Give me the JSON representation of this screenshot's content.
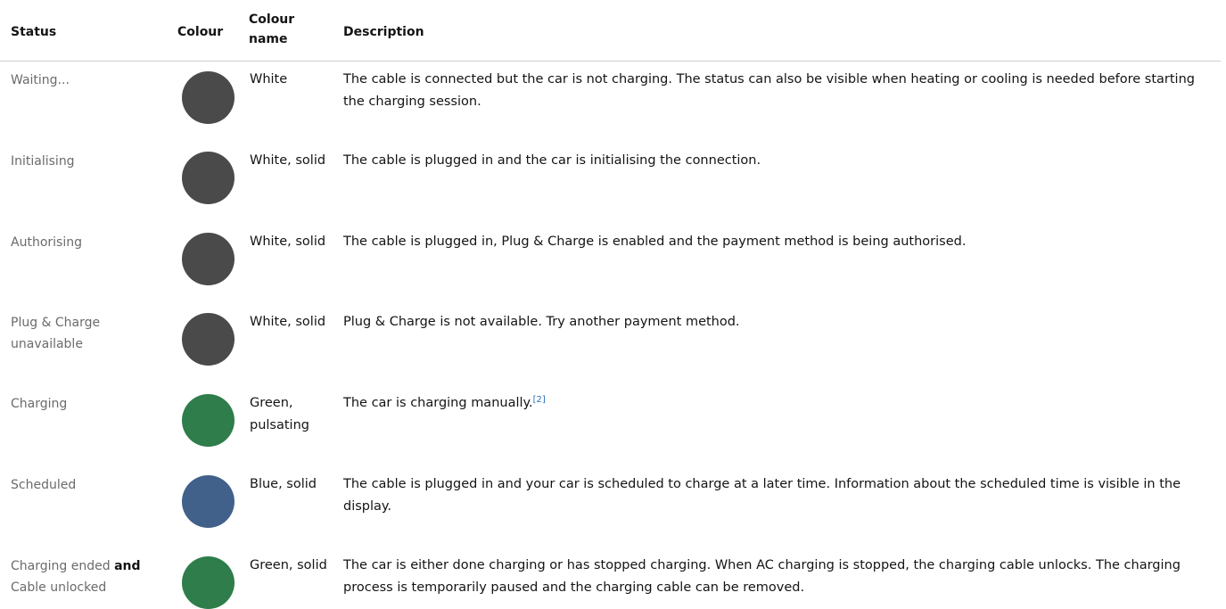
{
  "table": {
    "headers": {
      "status": "Status",
      "colour": "Colour",
      "colour_name_line1": "Colour",
      "colour_name_line2": "name",
      "description": "Description"
    },
    "rows": [
      {
        "status_lines": [
          "Waiting..."
        ],
        "dot_color": "#4a4a4a",
        "colour_name_lines": [
          "White"
        ],
        "description": "The cable is connected but the car is not charging. The status can also be visible when heating or cooling is needed before starting the charging session."
      },
      {
        "status_lines": [
          "Initialising"
        ],
        "dot_color": "#4a4a4a",
        "colour_name_lines": [
          "White, solid"
        ],
        "description": "The cable is plugged in and the car is initialising the connection."
      },
      {
        "status_lines": [
          "Authorising"
        ],
        "dot_color": "#4a4a4a",
        "colour_name_lines": [
          "White, solid"
        ],
        "description": "The cable is plugged in, Plug & Charge is enabled and the payment method is being authorised."
      },
      {
        "status_lines": [
          "Plug & Charge",
          "unavailable"
        ],
        "dot_color": "#4a4a4a",
        "colour_name_lines": [
          "White, solid"
        ],
        "description": "Plug & Charge is not available. Try another payment method."
      },
      {
        "status_lines": [
          "Charging"
        ],
        "dot_color": "#2e7d4a",
        "colour_name_lines": [
          "Green,",
          "pulsating"
        ],
        "description": "The car is charging manually.",
        "footnote": "[2]"
      },
      {
        "status_lines": [
          "Scheduled"
        ],
        "dot_color": "#41608a",
        "colour_name_lines": [
          "Blue, solid"
        ],
        "description": "The cable is plugged in and your car is scheduled to charge at a later time. Information about the scheduled time is visible in the display."
      },
      {
        "status_part1": "Charging ended",
        "status_and": "and",
        "status_part2": "Cable unlocked",
        "dot_color": "#2e7d4a",
        "colour_name_lines": [
          "Green, solid"
        ],
        "description": "The car is either done charging or has stopped charging. When AC charging is stopped, the charging cable unlocks. The charging process is temporarily paused and the charging cable can be removed."
      }
    ]
  }
}
